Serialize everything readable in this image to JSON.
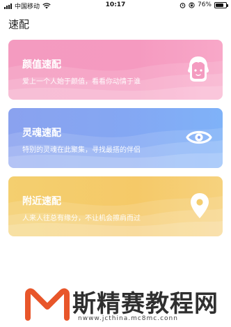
{
  "status_bar": {
    "carrier": "中国移动",
    "time": "10:17",
    "battery_percent": "76%",
    "battery_level": 0.76,
    "icons": [
      "signal-icon",
      "wifi-icon",
      "alarm-icon",
      "orientation-lock-icon",
      "battery-icon"
    ]
  },
  "page": {
    "title": "速配"
  },
  "cards": [
    {
      "title": "颜值速配",
      "subtitle": "爱上一个人始于颜值，看看你动情于谁",
      "icon": "girl-face-icon",
      "color": "#f49bc0"
    },
    {
      "title": "灵魂速配",
      "subtitle": "特别的灵魂在此聚集，寻找最搭的伴侣",
      "icon": "eye-icon",
      "color": "#86a4f1"
    },
    {
      "title": "附近速配",
      "subtitle": "人来人往总有缘分，不让机会擦肩而过",
      "icon": "location-pin-icon",
      "color": "#f4cd6e"
    }
  ],
  "watermark": {
    "text": "斯精赛教程网",
    "url": "nwww.jcthina.mc8mc.conn",
    "accent": "#e8562a"
  }
}
